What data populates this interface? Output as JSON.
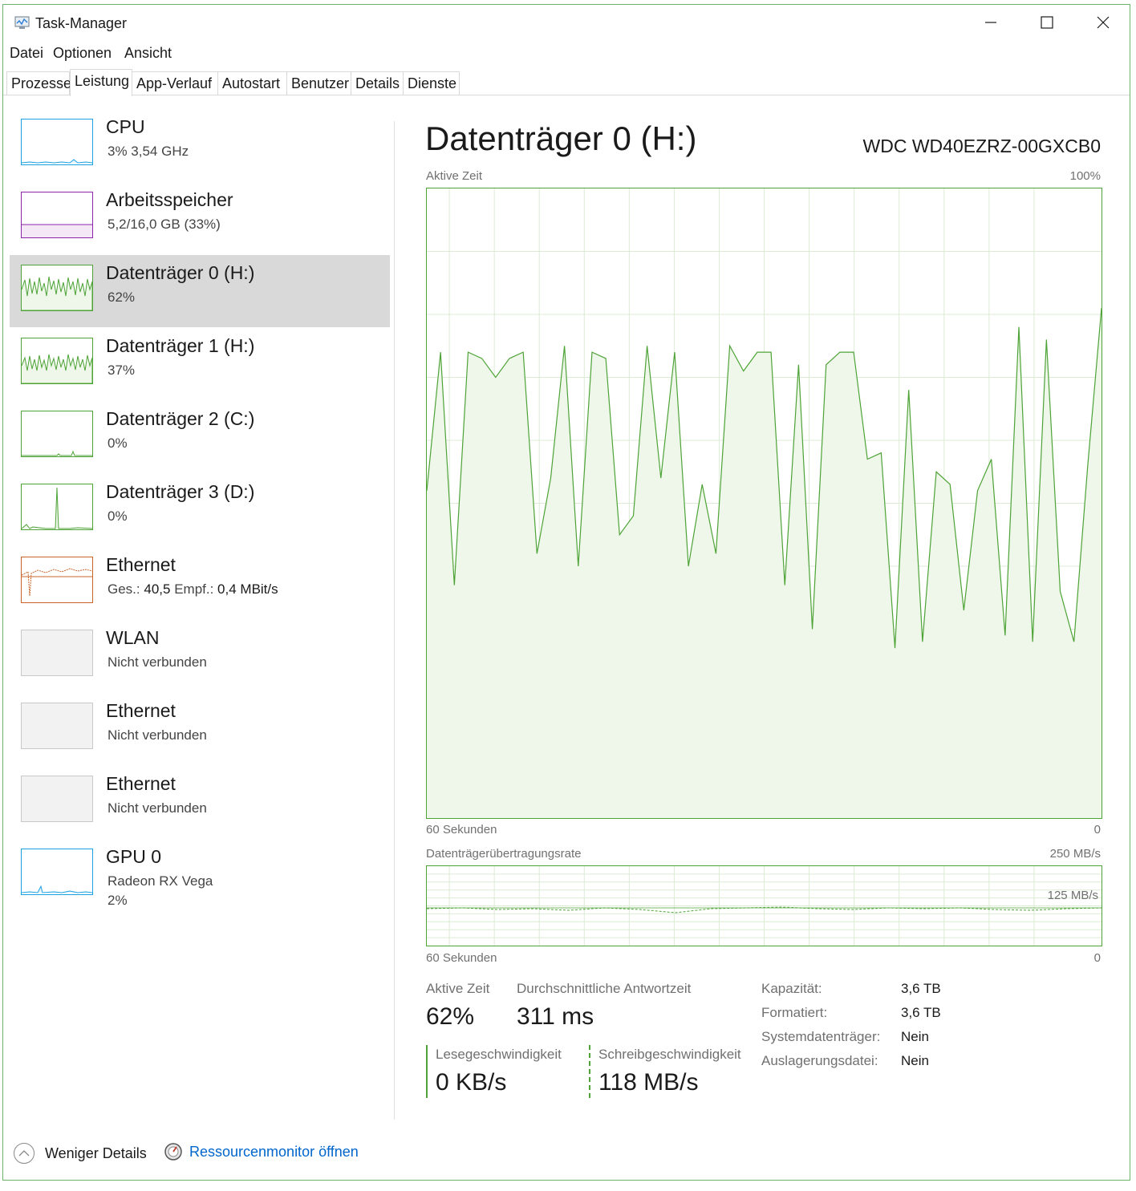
{
  "window": {
    "title": "Task-Manager"
  },
  "menu": {
    "items": [
      "Datei",
      "Optionen",
      "Ansicht"
    ]
  },
  "tabs": [
    "Prozesse",
    "Leistung",
    "App-Verlauf",
    "Autostart",
    "Benutzer",
    "Details",
    "Dienste"
  ],
  "sidebar": {
    "items": [
      {
        "title": "CPU",
        "subtitle": "3%  3,54 GHz",
        "color": "#1ba1e2"
      },
      {
        "title": "Arbeitsspeicher",
        "subtitle": "5,2/16,0 GB (33%)",
        "color": "#8e24aa"
      },
      {
        "title": "Datenträger 0 (H:)",
        "subtitle": "62%",
        "color": "#4da336"
      },
      {
        "title": "Datenträger 1 (H:)",
        "subtitle": "37%",
        "color": "#4da336"
      },
      {
        "title": "Datenträger 2 (C:)",
        "subtitle": "0%",
        "color": "#4da336"
      },
      {
        "title": "Datenträger 3 (D:)",
        "subtitle": "0%",
        "color": "#4da336"
      },
      {
        "title": "Ethernet",
        "subtitle_label_a": "Ges.:",
        "subtitle_value_a": "40,5",
        "subtitle_label_b": "Empf.:",
        "subtitle_value_b": "0,4 MBit/s",
        "color": "#c8642a"
      },
      {
        "title": "WLAN",
        "subtitle": "Nicht verbunden"
      },
      {
        "title": "Ethernet",
        "subtitle": "Nicht verbunden"
      },
      {
        "title": "Ethernet",
        "subtitle": "Nicht verbunden"
      },
      {
        "title": "GPU 0",
        "subtitle": "Radeon RX Vega",
        "subtitle2": "2%",
        "color": "#1ba1e2"
      }
    ]
  },
  "main": {
    "title": "Datenträger 0 (H:)",
    "model": "WDC WD40EZRZ-00GXCB0",
    "chart1": {
      "label": "Aktive Zeit",
      "max_label": "100%",
      "x_left": "60 Sekunden",
      "x_right": "0"
    },
    "chart2": {
      "label": "Datenträgerübertragungsrate",
      "max_label": "250 MB/s",
      "mid_label": "125 MB/s",
      "x_left": "60 Sekunden",
      "x_right": "0"
    }
  },
  "stats": {
    "active_time_label": "Aktive Zeit",
    "active_time_value": "62%",
    "response_label": "Durchschnittliche Antwortzeit",
    "response_value": "311 ms",
    "read_label": "Lesegeschwindigkeit",
    "read_value": "0 KB/s",
    "write_label": "Schreibgeschwindigkeit",
    "write_value": "118 MB/s"
  },
  "properties": [
    {
      "label": "Kapazität:",
      "value": "3,6 TB"
    },
    {
      "label": "Formatiert:",
      "value": "3,6 TB"
    },
    {
      "label": "Systemdatenträger:",
      "value": "Nein"
    },
    {
      "label": "Auslagerungsdatei:",
      "value": "Nein"
    }
  ],
  "footer": {
    "less_details": "Weniger Details",
    "resource_monitor": "Ressourcenmonitor öffnen"
  },
  "chart_data": {
    "type": "area",
    "ylim": [
      0,
      100
    ],
    "values": [
      52,
      74,
      37,
      74,
      73,
      70,
      73,
      74,
      42,
      54,
      75,
      40,
      74,
      73,
      45,
      48,
      75,
      54,
      74,
      40,
      53,
      42,
      75,
      71,
      74,
      74,
      37,
      72,
      30,
      72,
      74,
      74,
      57,
      58,
      27,
      68,
      28,
      55,
      53,
      33,
      52,
      57,
      29,
      78,
      28,
      76,
      36,
      28,
      56,
      81
    ]
  }
}
